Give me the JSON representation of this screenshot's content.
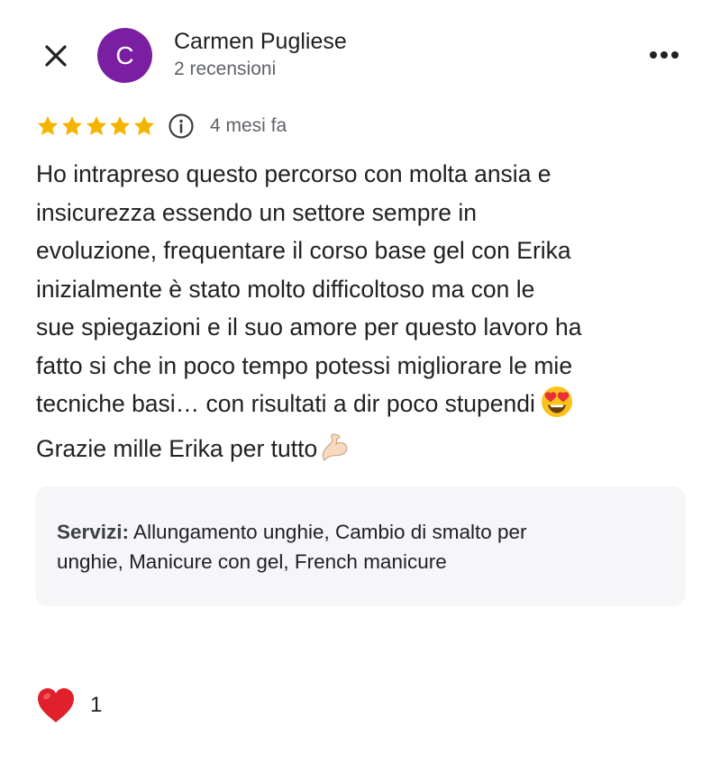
{
  "header": {
    "close_icon": "close-icon",
    "avatar": {
      "initial": "C",
      "color": "#7b1fa2"
    },
    "author_name": "Carmen Pugliese",
    "author_meta": "2 recensioni",
    "more_icon": "more-horizontal-icon"
  },
  "rating": {
    "stars": 5,
    "max_stars": 5,
    "star_color": "#f4b400",
    "info_icon": "info-icon",
    "time_ago": "4 mesi fa"
  },
  "review": {
    "lines": [
      "Ho intrapreso questo percorso con molta ansia e",
      "insicurezza essendo un settore sempre in",
      "evoluzione, frequentare il corso base gel con Erika",
      "inizialmente è stato molto difficoltoso ma con le",
      "sue spiegazioni e il suo amore per questo lavoro ha",
      "fatto si che in poco tempo potessi migliorare le mie",
      "tecniche basi… con risultati a dir poco stupendi",
      "Grazie mille Erika per tutto"
    ],
    "emoji_heart_eyes": "heart-eyes-emoji",
    "emoji_flexed_biceps": "flexed-biceps-emoji"
  },
  "services": {
    "label": "Servizi:",
    "line1_rest": " Allungamento unghie, Cambio di smalto per",
    "line2": "unghie, Manicure con gel, French manicure",
    "background": "#f6f6f8"
  },
  "reactions": {
    "like_icon": "red-heart-icon",
    "like_color": "#e0202a",
    "like_count": "1"
  }
}
